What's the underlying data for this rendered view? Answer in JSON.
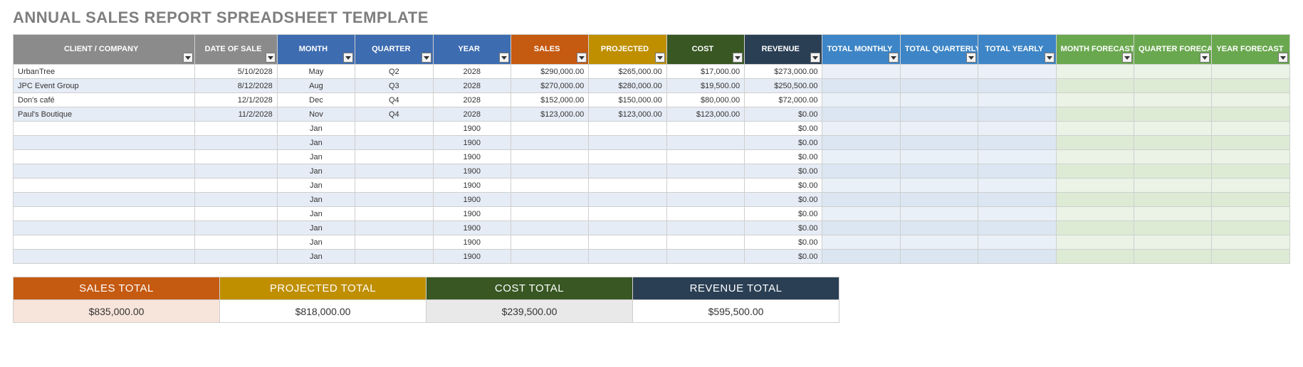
{
  "title": "ANNUAL SALES REPORT SPREADSHEET TEMPLATE",
  "headers": {
    "client": "CLIENT / COMPANY",
    "date": "DATE OF SALE",
    "month": "MONTH",
    "quarter": "QUARTER",
    "year": "YEAR",
    "sales": "SALES",
    "projected": "PROJECTED",
    "cost": "COST",
    "revenue": "REVENUE",
    "total_monthly": "TOTAL MONTHLY",
    "total_quarterly": "TOTAL QUARTERLY",
    "total_yearly": "TOTAL YEARLY",
    "month_forecast": "MONTH FORECAST",
    "quarter_forecast": "QUARTER FORECAST",
    "year_forecast": "YEAR FORECAST"
  },
  "rows": [
    {
      "client": "UrbanTree",
      "date": "5/10/2028",
      "month": "May",
      "quarter": "Q2",
      "year": "2028",
      "sales": "$290,000.00",
      "projected": "$265,000.00",
      "cost": "$17,000.00",
      "revenue": "$273,000.00"
    },
    {
      "client": "JPC Event Group",
      "date": "8/12/2028",
      "month": "Aug",
      "quarter": "Q3",
      "year": "2028",
      "sales": "$270,000.00",
      "projected": "$280,000.00",
      "cost": "$19,500.00",
      "revenue": "$250,500.00"
    },
    {
      "client": "Don's café",
      "date": "12/1/2028",
      "month": "Dec",
      "quarter": "Q4",
      "year": "2028",
      "sales": "$152,000.00",
      "projected": "$150,000.00",
      "cost": "$80,000.00",
      "revenue": "$72,000.00"
    },
    {
      "client": "Paul's Boutique",
      "date": "11/2/2028",
      "month": "Nov",
      "quarter": "Q4",
      "year": "2028",
      "sales": "$123,000.00",
      "projected": "$123,000.00",
      "cost": "$123,000.00",
      "revenue": "$0.00"
    },
    {
      "client": "",
      "date": "",
      "month": "Jan",
      "quarter": "",
      "year": "1900",
      "sales": "",
      "projected": "",
      "cost": "",
      "revenue": "$0.00"
    },
    {
      "client": "",
      "date": "",
      "month": "Jan",
      "quarter": "",
      "year": "1900",
      "sales": "",
      "projected": "",
      "cost": "",
      "revenue": "$0.00"
    },
    {
      "client": "",
      "date": "",
      "month": "Jan",
      "quarter": "",
      "year": "1900",
      "sales": "",
      "projected": "",
      "cost": "",
      "revenue": "$0.00"
    },
    {
      "client": "",
      "date": "",
      "month": "Jan",
      "quarter": "",
      "year": "1900",
      "sales": "",
      "projected": "",
      "cost": "",
      "revenue": "$0.00"
    },
    {
      "client": "",
      "date": "",
      "month": "Jan",
      "quarter": "",
      "year": "1900",
      "sales": "",
      "projected": "",
      "cost": "",
      "revenue": "$0.00"
    },
    {
      "client": "",
      "date": "",
      "month": "Jan",
      "quarter": "",
      "year": "1900",
      "sales": "",
      "projected": "",
      "cost": "",
      "revenue": "$0.00"
    },
    {
      "client": "",
      "date": "",
      "month": "Jan",
      "quarter": "",
      "year": "1900",
      "sales": "",
      "projected": "",
      "cost": "",
      "revenue": "$0.00"
    },
    {
      "client": "",
      "date": "",
      "month": "Jan",
      "quarter": "",
      "year": "1900",
      "sales": "",
      "projected": "",
      "cost": "",
      "revenue": "$0.00"
    },
    {
      "client": "",
      "date": "",
      "month": "Jan",
      "quarter": "",
      "year": "1900",
      "sales": "",
      "projected": "",
      "cost": "",
      "revenue": "$0.00"
    },
    {
      "client": "",
      "date": "",
      "month": "Jan",
      "quarter": "",
      "year": "1900",
      "sales": "",
      "projected": "",
      "cost": "",
      "revenue": "$0.00"
    }
  ],
  "totals": {
    "sales_label": "SALES TOTAL",
    "projected_label": "PROJECTED TOTAL",
    "cost_label": "COST TOTAL",
    "revenue_label": "REVENUE TOTAL",
    "sales_value": "$835,000.00",
    "projected_value": "$818,000.00",
    "cost_value": "$239,500.00",
    "revenue_value": "$595,500.00"
  }
}
